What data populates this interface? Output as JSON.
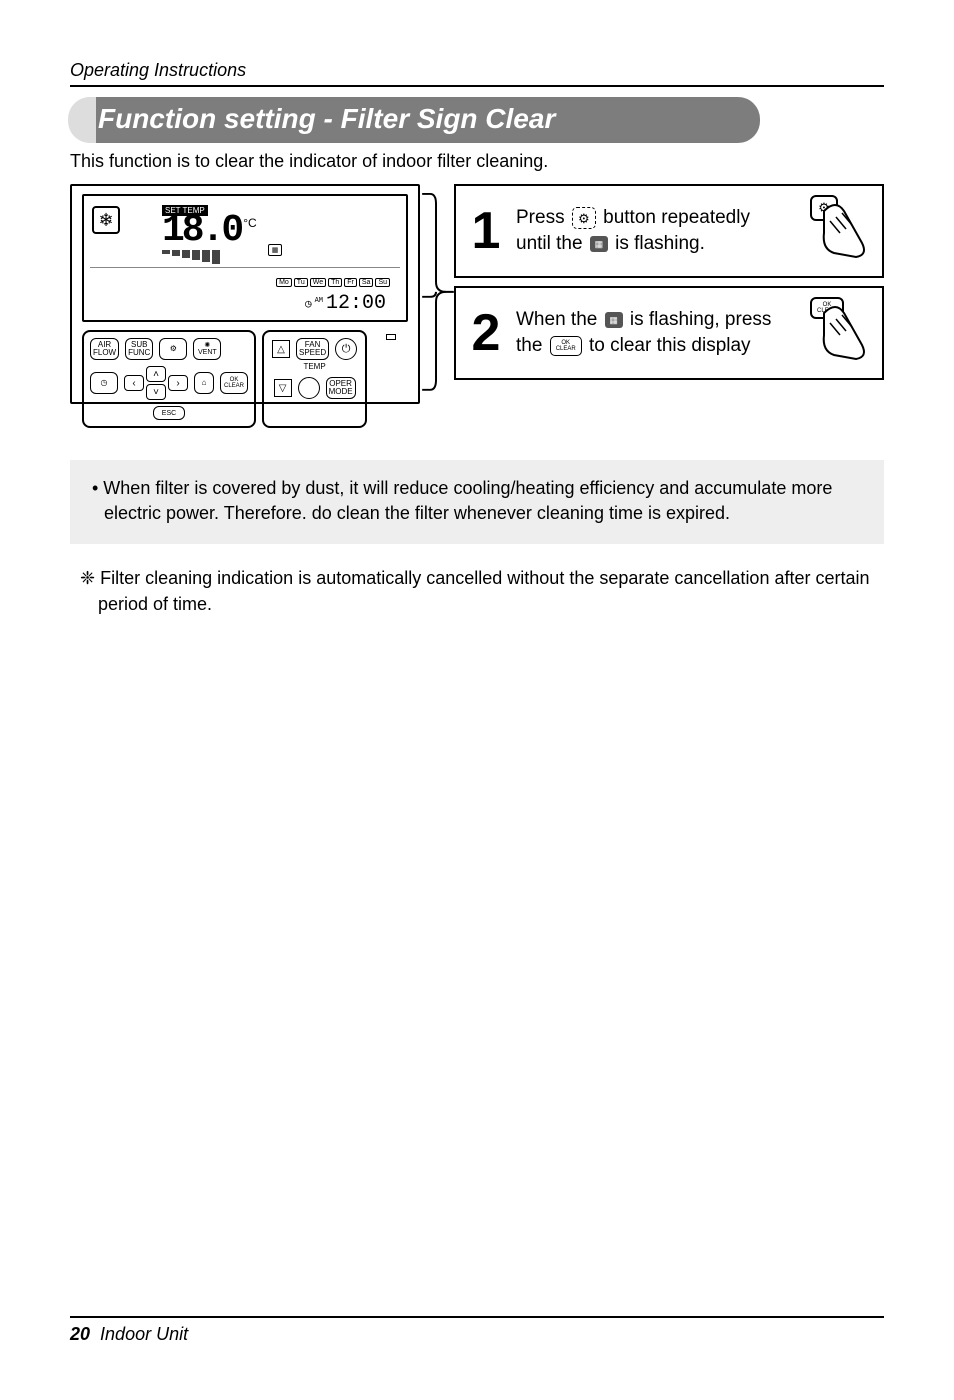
{
  "header_italic": "Operating Instructions",
  "banner_title": "Function setting - Filter Sign Clear",
  "intro_line": "This function is to clear the indicator of indoor filter cleaning.",
  "remote": {
    "set_temp_label": "SET TEMP",
    "temp_value": "18.0",
    "temp_unit": "°C",
    "days": [
      "Mo",
      "Tu",
      "We",
      "Th",
      "Fr",
      "Sa",
      "Su"
    ],
    "clock_am": "AM",
    "clock": "12:00",
    "btn_air_flow": "AIR\nFLOW",
    "btn_sub_func": "SUB\nFUNC",
    "btn_vent": "VENT",
    "btn_ok_clear_top": "OK",
    "btn_ok_clear_bottom": "CLEAR",
    "btn_esc": "ESC",
    "btn_fan_speed": "FAN\nSPEED",
    "btn_temp_label": "TEMP",
    "btn_oper_mode": "OPER\nMODE"
  },
  "steps": {
    "s1_num": "1",
    "s1_pre": "Press ",
    "s1_mid": " button repeatedly until the ",
    "s1_post": " is flashing.",
    "s2_num": "2",
    "s2_pre": "When the ",
    "s2_mid": " is flashing, press the ",
    "s2_post": " to clear this display",
    "ok_label_top": "OK",
    "ok_label_bottom": "CLEAR"
  },
  "note_bullet": "• When filter is covered by dust, it will reduce cooling/heating efficiency and accumulate more electric power. Therefore. do clean the filter whenever cleaning time is expired.",
  "extra_note": "❈ Filter cleaning indication is automatically cancelled without the separate cancellation after certain period of time.",
  "footer": {
    "page_num": "20",
    "label": "Indoor Unit"
  }
}
